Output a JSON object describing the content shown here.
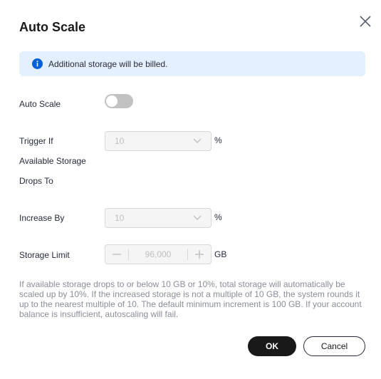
{
  "dialog": {
    "title": "Auto Scale",
    "banner_text": "Additional storage will be billed.",
    "auto_scale": {
      "label": "Auto Scale",
      "enabled": false
    },
    "trigger": {
      "label_line1": "Trigger If",
      "label_line2": "Available Storage",
      "label_line3": "Drops To",
      "value": "10",
      "unit": "%"
    },
    "increase": {
      "label": "Increase By",
      "value": "10",
      "unit": "%"
    },
    "storage_limit": {
      "label": "Storage Limit",
      "value": "96,000",
      "unit": "GB",
      "minus": "—",
      "plus": "+"
    },
    "description": "If available storage drops to or below 10 GB or 10%, total storage will automatically be scaled up by 10%. If the increased storage is not a multiple of 10 GB, the system rounds it up to the nearest multiple of 10. The default minimum increment is 100 GB. If your account balance is insufficient, autoscaling will fail.",
    "ok_label": "OK",
    "cancel_label": "Cancel"
  },
  "colors": {
    "banner_bg": "#e5f0fe",
    "info_icon": "#0062d6",
    "primary_button": "#191919",
    "toggle_off": "#c2c2c2"
  },
  "icons": [
    "close-icon",
    "info-icon",
    "chevron-down-icon",
    "minus-icon",
    "plus-icon"
  ]
}
